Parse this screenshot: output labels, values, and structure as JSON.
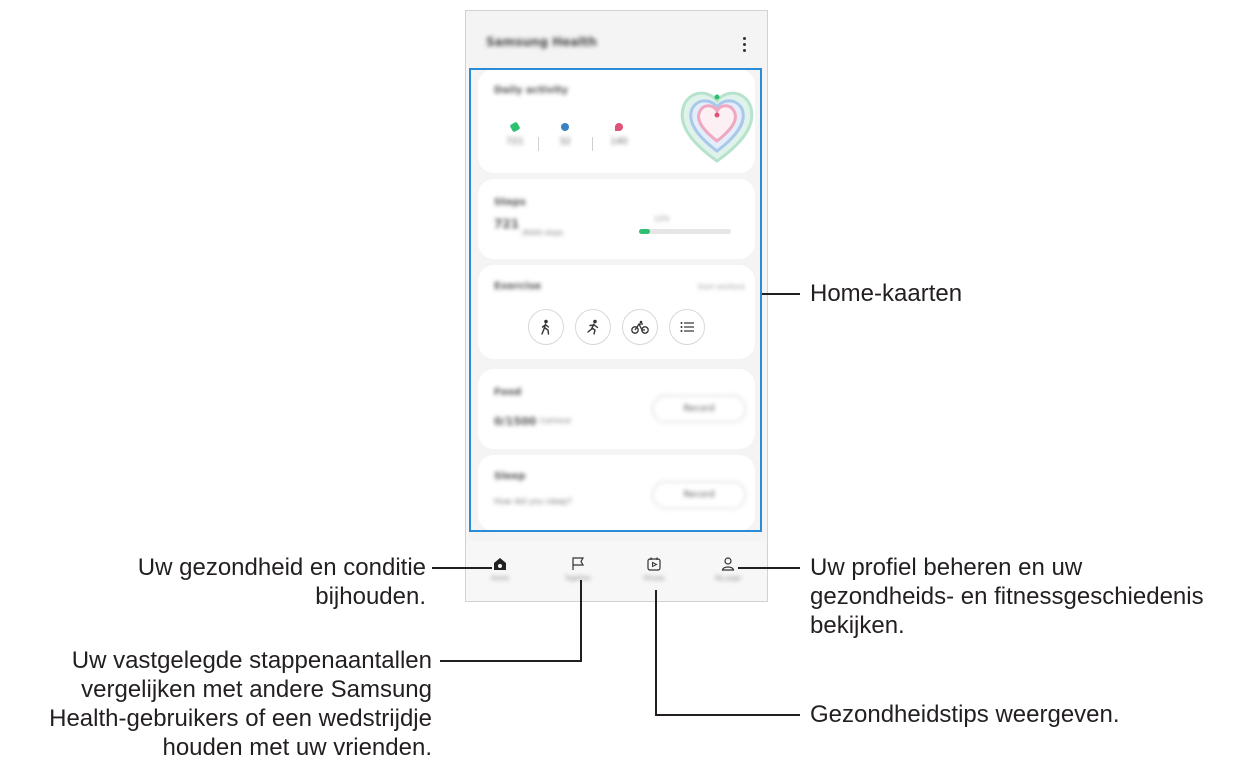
{
  "app": {
    "title": "Samsung Health"
  },
  "cards": {
    "daily_activity": {
      "title": "Daily activity",
      "steps": "721",
      "minutes": "32",
      "calories": "140"
    },
    "steps": {
      "title": "Steps",
      "count": "721",
      "goal": "/6000 steps",
      "progress_label": "12%",
      "progress": 0.12
    },
    "exercise": {
      "title": "Exercise",
      "action": "Start workout"
    },
    "food": {
      "title": "Food",
      "value": "0/1500",
      "unit": "Cal/meal",
      "button": "Record"
    },
    "sleep": {
      "title": "Sleep",
      "subtitle": "How did you sleep?",
      "button": "Record"
    }
  },
  "bottom_nav": {
    "items": [
      {
        "label": "Home",
        "icon": "home-icon"
      },
      {
        "label": "Together",
        "icon": "flag-icon"
      },
      {
        "label": "Fitness",
        "icon": "play-calendar-icon"
      },
      {
        "label": "My page",
        "icon": "person-icon"
      }
    ]
  },
  "callouts": {
    "home_cards": "Home-kaarten",
    "home_line1": "Uw gezondheid en conditie",
    "home_line2": "bijhouden.",
    "together_line1": "Uw vastgelegde stappenaantallen",
    "together_line2": "vergelijken met andere Samsung",
    "together_line3": "Health-gebruikers of een wedstrijdje",
    "together_line4": "houden met uw vrienden.",
    "profile_line1": "Uw profiel beheren en uw",
    "profile_line2": "gezondheids- en fitnessgeschiedenis",
    "profile_line3": "bekijken.",
    "fitness": "Gezondheidstips weergeven."
  },
  "colors": {
    "highlight": "#2a8cd6",
    "steps_green": "#2fbf71",
    "active_blue": "#3b82c4",
    "calorie_pink": "#e0527a"
  }
}
